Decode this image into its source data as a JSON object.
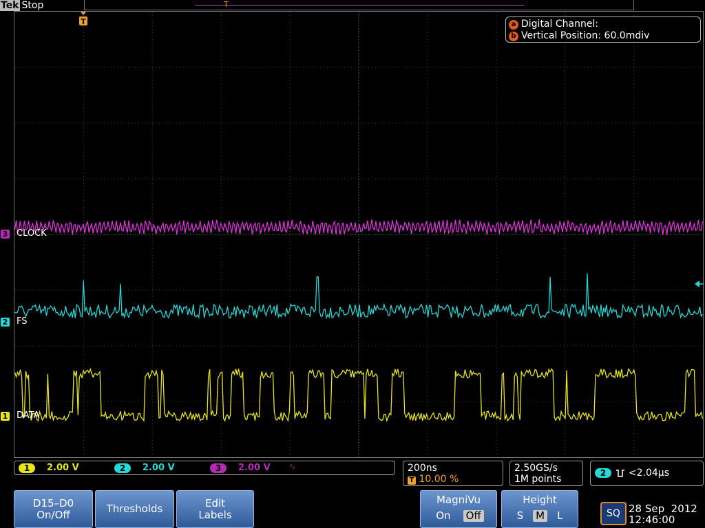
{
  "header": {
    "brand": "Tek",
    "acq_state": "Stop",
    "trigger_marker": "T",
    "record_marker": "T"
  },
  "info_panel": {
    "line_a": {
      "badge": "a",
      "text": "Digital Channel:"
    },
    "line_b": {
      "badge": "b",
      "text": "Vertical Position: 60.0mdiv"
    }
  },
  "channels": [
    {
      "id": "3",
      "label": "CLOCK",
      "color": "#d936d9"
    },
    {
      "id": "2",
      "label": "FS",
      "color": "#27d6d6"
    },
    {
      "id": "1",
      "label": "DATA",
      "color": "#e8e51c"
    }
  ],
  "channel_status": [
    {
      "id": "1",
      "scale": "2.00 V",
      "color": "#e8e51c"
    },
    {
      "id": "2",
      "scale": "2.00 V",
      "color": "#27d6d6"
    },
    {
      "id": "3",
      "scale": "2.00 V",
      "color": "#b22cb2",
      "note": "⁰₂"
    }
  ],
  "horizontal": {
    "scale": "200ns",
    "trigger_badge": "T",
    "position": "10.00 %"
  },
  "sampling": {
    "rate": "2.50GS/s",
    "record": "1M points"
  },
  "trigger": {
    "channel": "2",
    "symbol": "⨆",
    "condition": "<2.04µs"
  },
  "buttons": {
    "digital": {
      "line1": "D15–D0",
      "line2": "On/Off"
    },
    "thresholds": "Thresholds",
    "edit_labels": {
      "line1": "Edit",
      "line2": "Labels"
    },
    "magnivu": {
      "title": "MagniVu",
      "on": "On",
      "off": "Off"
    },
    "height": {
      "title": "Height",
      "s": "S",
      "m": "M",
      "l": "L"
    },
    "sq": "SQ"
  },
  "datetime": {
    "date": "28 Sep  2012",
    "time": "12:46:00"
  },
  "colors": {
    "accent_orange": "#e05a1e",
    "button_blue": "#3f6db0"
  }
}
